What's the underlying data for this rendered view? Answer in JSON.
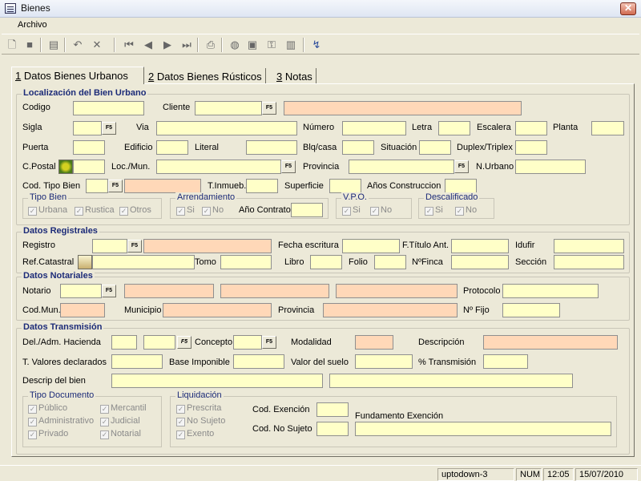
{
  "window": {
    "title": "Bienes",
    "close_glyph": "✕"
  },
  "menu": {
    "items": [
      {
        "label": "Archivo"
      }
    ]
  },
  "toolbar": {
    "icons": [
      "new-doc-icon",
      "stop-icon",
      "save-icon",
      "undo-icon",
      "delete-icon",
      "first-record-icon",
      "prev-record-icon",
      "next-record-icon",
      "last-record-icon",
      "print-icon",
      "world-icon",
      "comment-icon",
      "key-icon",
      "document-icon",
      "refresh-icon"
    ]
  },
  "tabs": [
    {
      "num": "1",
      "label": " Datos Bienes Urbanos"
    },
    {
      "num": "2",
      "label": " Datos Bienes Rústicos"
    },
    {
      "num": "3",
      "label": " Notas"
    }
  ],
  "f5_label": "F5",
  "check_mark": "✓",
  "urbano": {
    "title": "Localización del Bien Urbano",
    "labels": {
      "codigo": "Codigo",
      "cliente": "Cliente",
      "sigla": "Sigla",
      "via": "Via",
      "numero": "Número",
      "letra": "Letra",
      "escalera": "Escalera",
      "planta": "Planta",
      "puerta": "Puerta",
      "edificio": "Edificio",
      "literal": "Literal",
      "blq": "Blq/casa",
      "situacion": "Situación",
      "duplex": "Duplex/Triplex",
      "cpostal": "C.Postal",
      "locmun": "Loc./Mun.",
      "provincia": "Provincia",
      "nurbano": "N.Urbano",
      "codtipo": "Cod. Tipo Bien",
      "tinmueb": "T.Inmueb.",
      "superficie": "Superficie",
      "anos": "Años Construccion",
      "anocontrato": "Año Contrato"
    },
    "tipo_bien": {
      "title": "Tipo Bien",
      "options": [
        "Urbana",
        "Rustica",
        "Otros"
      ]
    },
    "arrendamiento": {
      "title": "Arrendamiento",
      "options": [
        "Si",
        "No"
      ]
    },
    "vpo": {
      "title": "V.P.O.",
      "options": [
        "Si",
        "No"
      ]
    },
    "descalificado": {
      "title": "Descalificado",
      "options": [
        "Si",
        "No"
      ]
    }
  },
  "registrales": {
    "title": "Datos Registrales",
    "labels": {
      "registro": "Registro",
      "fecha": "Fecha escritura",
      "ftitulo": "F.Título Ant.",
      "idufir": "Idufir",
      "refcat": "Ref.Catastral",
      "tomo": "Tomo",
      "libro": "Libro",
      "folio": "Folio",
      "nfinca": "NºFinca",
      "seccion": "Sección"
    }
  },
  "notariales": {
    "title": "Datos Notariales",
    "labels": {
      "notario": "Notario",
      "protocolo": "Protocolo",
      "codmun": "Cod.Mun.",
      "municipio": "Municipio",
      "provincia": "Provincia",
      "nfijo": "Nº Fijo"
    }
  },
  "transmision": {
    "title": "Datos Transmisión",
    "labels": {
      "deladm": "Del./Adm. Hacienda",
      "concepto": "Concepto",
      "modalidad": "Modalidad",
      "descripcion": "Descripción",
      "tvalores": "T. Valores declarados",
      "baseimp": "Base Imponible",
      "valorsuelo": "Valor del suelo",
      "ptrans": "% Transmisión",
      "descripbien": "Descrip del bien",
      "codexencion": "Cod. Exención",
      "fundamento": "Fundamento Exención",
      "codnosujeto": "Cod. No Sujeto"
    },
    "tipo_documento": {
      "title": "Tipo Documento",
      "col1": [
        "Público",
        "Administrativo",
        "Privado"
      ],
      "col2": [
        "Mercantil",
        "Judicial",
        "Notarial"
      ]
    },
    "liquidacion": {
      "title": "Liquidación",
      "options": [
        "Prescrita",
        "No Sujeto",
        "Exento"
      ]
    }
  },
  "status": {
    "machine": "uptodown-3",
    "numlock": "NUM",
    "time": "12:05",
    "date": "15/07/2010"
  },
  "colors": {
    "panel": "#ece9d8",
    "input_yellow": "#ffffc8",
    "input_orange": "#ffd8b8",
    "section_title": "#1c2b78"
  }
}
